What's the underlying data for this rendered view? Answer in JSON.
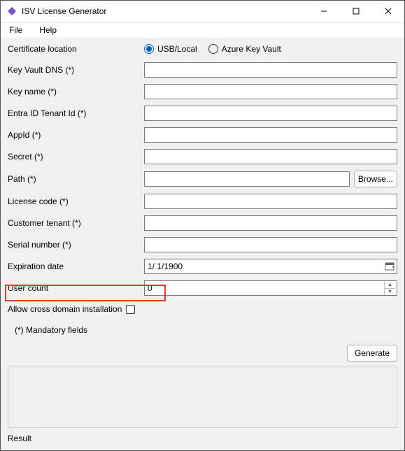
{
  "window": {
    "title": "ISV License Generator"
  },
  "menu": {
    "file": "File",
    "help": "Help"
  },
  "labels": {
    "cert_location": "Certificate location",
    "key_vault_dns": "Key Vault DNS (*)",
    "key_name": "Key name (*)",
    "tenant_id": "Entra ID Tenant Id (*)",
    "app_id": "AppId (*)",
    "secret": "Secret (*)",
    "path": "Path (*)",
    "license_code": "License code (*)",
    "customer_tenant": "Customer tenant (*)",
    "serial_number": "Serial number (*)",
    "expiration_date": "Expiration date",
    "user_count": "User count",
    "allow_cross": "Allow cross domain installation",
    "mandatory": "(*) Mandatory fields",
    "result": "Result"
  },
  "radio": {
    "usb_local": "USB/Local",
    "azure": "Azure Key Vault",
    "selected": "usb_local"
  },
  "buttons": {
    "browse": "Browse...",
    "generate": "Generate"
  },
  "values": {
    "key_vault_dns": "",
    "key_name": "",
    "tenant_id": "",
    "app_id": "",
    "secret": "",
    "path": "",
    "license_code": "",
    "customer_tenant": "",
    "serial_number": "",
    "expiration_date": "1/  1/1900",
    "user_count": "0",
    "allow_cross_checked": false
  }
}
